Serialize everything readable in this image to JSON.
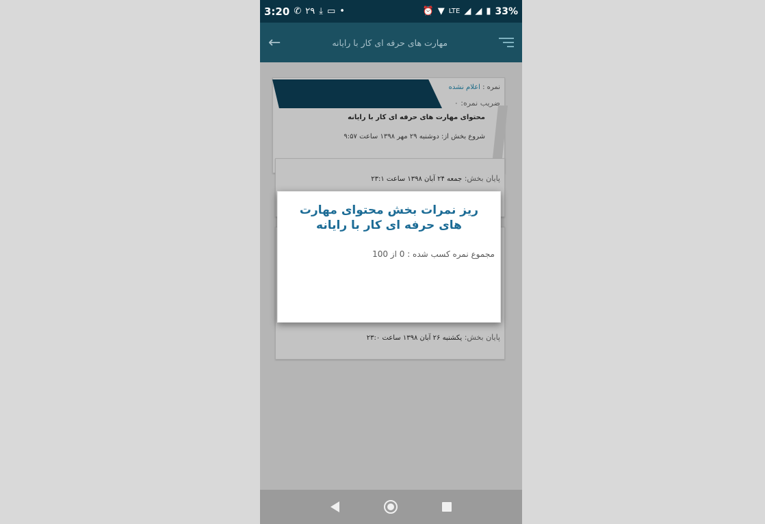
{
  "status_bar": {
    "time": "3:20",
    "date_badge": "۲۹",
    "network": "LTE",
    "battery": "33%"
  },
  "app_bar": {
    "title": "مهارت های حرفه ای کار با رایانه"
  },
  "cards": [
    {
      "grade_prefix": "نمره :",
      "grade_value": "اعلام نشده",
      "coefficient": "ضریب نمره: ۰",
      "course_name": "محتوای مهارت های حرفه ای کار با رایانه",
      "start_date": "شروع بخش از: دوشنبه ۲۹ مهر ۱۳۹۸ ساعت ۹:۵۷"
    },
    {
      "end_label": "پایان بخش:",
      "end_date": "جمعه ۲۴ آبان ۱۳۹۸ ساعت ۲۳:۱"
    },
    {
      "end_label": "پایان بخش:",
      "end_date": "یکشنبه ۲۶ آبان ۱۳۹۸ ساعت ۲۳:۰"
    }
  ],
  "dialog": {
    "title": "ریز نمرات بخش محتوای مهارت های حرفه ای کار با رایانه",
    "total_text": "مجموع نمره کسب شده : 0 از 100"
  },
  "colors": {
    "status_bar": "#0a3344",
    "app_bar": "#1b5061",
    "dialog_title": "#1b6b95"
  }
}
